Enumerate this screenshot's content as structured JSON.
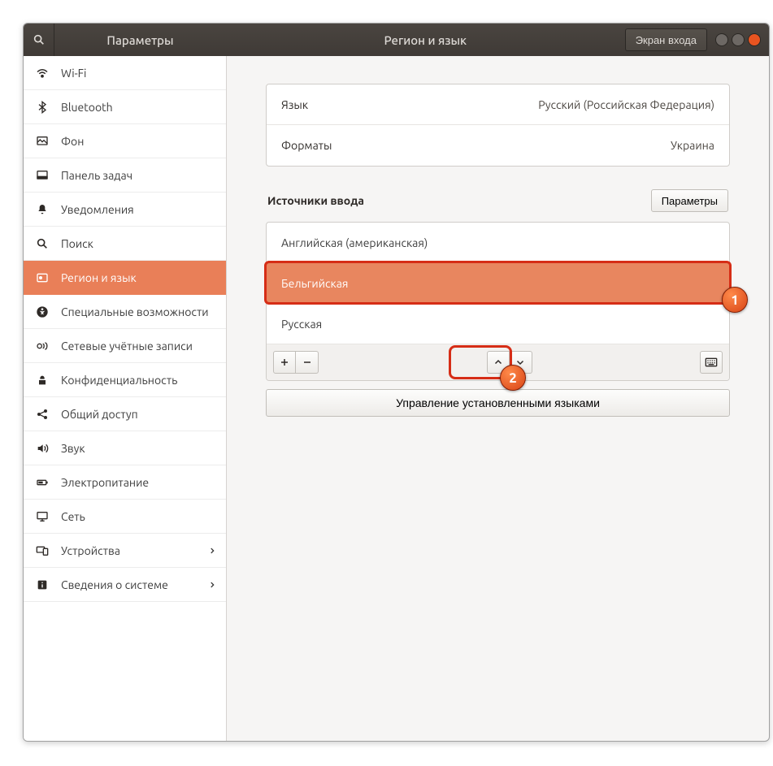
{
  "titlebar": {
    "app_title": "Параметры",
    "page_title": "Регион и язык",
    "login_screen_label": "Экран входа"
  },
  "sidebar": {
    "items": [
      {
        "icon": "wifi",
        "label": "Wi-Fi"
      },
      {
        "icon": "bluetooth",
        "label": "Bluetooth"
      },
      {
        "icon": "background",
        "label": "Фон"
      },
      {
        "icon": "dock",
        "label": "Панель задач"
      },
      {
        "icon": "bell",
        "label": "Уведомления"
      },
      {
        "icon": "search",
        "label": "Поиск"
      },
      {
        "icon": "region",
        "label": "Регион и язык"
      },
      {
        "icon": "accessibility",
        "label": "Специальные возможности"
      },
      {
        "icon": "online-accounts",
        "label": "Сетевые учётные записи"
      },
      {
        "icon": "privacy",
        "label": "Конфиденциальность"
      },
      {
        "icon": "sharing",
        "label": "Общий доступ"
      },
      {
        "icon": "sound",
        "label": "Звук"
      },
      {
        "icon": "power",
        "label": "Электропитание"
      },
      {
        "icon": "network",
        "label": "Сеть"
      },
      {
        "icon": "devices",
        "label": "Устройства"
      },
      {
        "icon": "about",
        "label": "Сведения о системе"
      }
    ]
  },
  "main": {
    "language_label": "Язык",
    "language_value": "Русский (Российская Федерация)",
    "formats_label": "Форматы",
    "formats_value": "Украина",
    "input_sources_title": "Источники ввода",
    "options_btn": "Параметры",
    "sources": [
      "Английская (американская)",
      "Бельгийская",
      "Русская"
    ],
    "manage_languages_btn": "Управление установленными языками"
  },
  "annotations": {
    "badge1": "1",
    "badge2": "2"
  }
}
